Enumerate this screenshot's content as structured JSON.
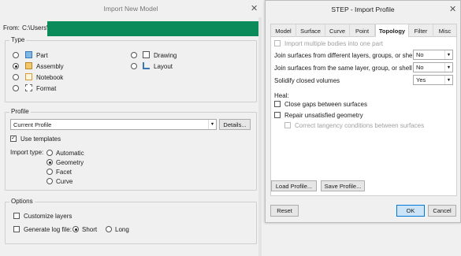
{
  "left_window": {
    "title": "Import New Model",
    "from_label": "From:",
    "from_path": "C:\\Users\\",
    "type": {
      "title": "Type",
      "items": [
        {
          "label": "Part",
          "icon": "part-icon",
          "selected": false
        },
        {
          "label": "Assembly",
          "icon": "assembly-icon",
          "selected": true
        },
        {
          "label": "Notebook",
          "icon": "notebook-icon",
          "selected": false
        },
        {
          "label": "Format",
          "icon": "format-icon",
          "selected": false
        },
        {
          "label": "Drawing",
          "icon": "drawing-icon",
          "selected": false
        },
        {
          "label": "Layout",
          "icon": "layout-icon",
          "selected": false
        }
      ]
    },
    "profile": {
      "title": "Profile",
      "value": "Current Profile",
      "details_label": "Details...",
      "use_templates_label": "Use templates",
      "use_templates_checked": true,
      "import_type_label": "Import type:",
      "import_types": [
        "Automatic",
        "Geometry",
        "Facet",
        "Curve"
      ],
      "import_type_selected": "Geometry"
    },
    "options": {
      "title": "Options",
      "customize_layers_label": "Customize layers",
      "generate_log_label": "Generate log file:",
      "log_short_label": "Short",
      "log_long_label": "Long",
      "log_selected": "Short"
    },
    "colors": {
      "redaction": "#0b8a5a"
    }
  },
  "right_window": {
    "title": "STEP - Import Profile",
    "tabs": [
      "Model",
      "Surface",
      "Curve",
      "Point",
      "Topology",
      "Filter",
      "Misc"
    ],
    "active_tab": "Topology",
    "import_multiple_label": "Import multiple bodies into one part",
    "join_diff_label": "Join surfaces from different layers, groups, or shells",
    "join_diff_value": "No",
    "join_same_label": "Join surfaces from the same layer, group, or shell",
    "join_same_value": "No",
    "solidify_label": "Solidify closed volumes",
    "solidify_value": "Yes",
    "heal_label": "Heal:",
    "close_gaps_label": "Close gaps between surfaces",
    "repair_label": "Repair unsatisfied geometry",
    "correct_tangency_label": "Correct tangency conditions between surfaces",
    "load_profile_label": "Load Profile...",
    "save_profile_label": "Save Profile...",
    "reset_label": "Reset",
    "ok_label": "OK",
    "cancel_label": "Cancel"
  }
}
